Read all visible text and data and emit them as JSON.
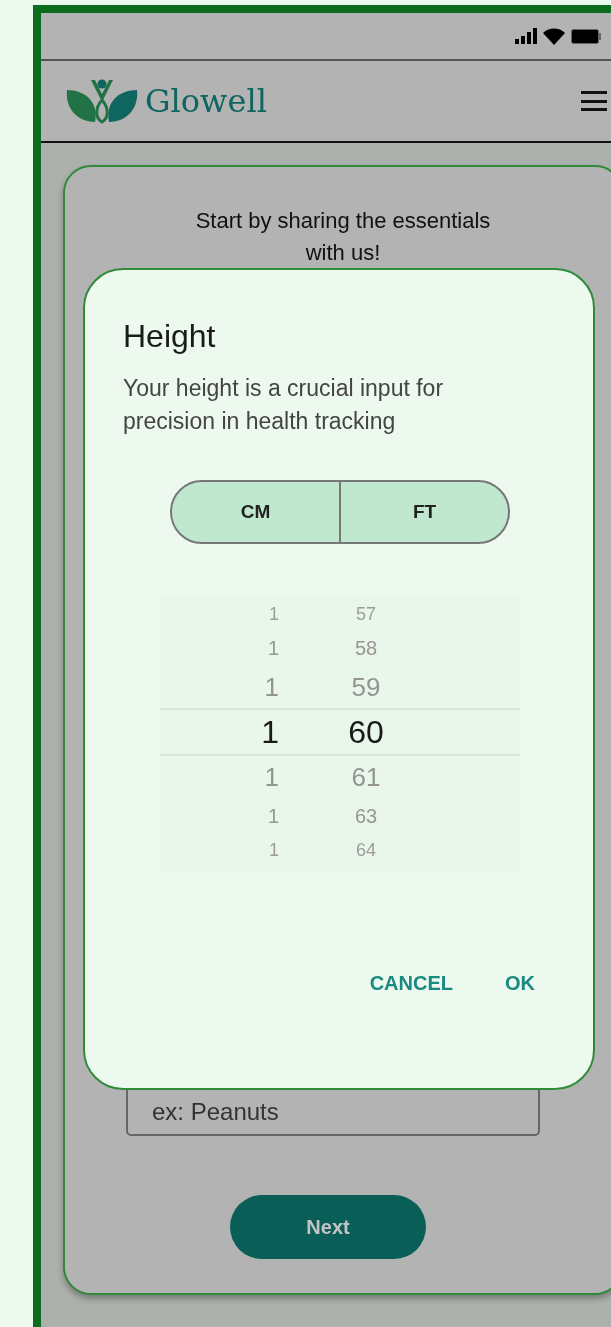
{
  "app": {
    "name": "Glowell"
  },
  "card": {
    "heading": "Start by sharing the essentials with us!",
    "field": {
      "placeholder": "ex: Peanuts"
    },
    "next_button": "Next"
  },
  "dialog": {
    "title": "Height",
    "description": "Your height is a crucial input for precision in health tracking",
    "units": [
      {
        "label": "CM"
      },
      {
        "label": "FT"
      }
    ],
    "picker": [
      {
        "feet": "1",
        "cm": "57",
        "selected": false
      },
      {
        "feet": "1",
        "cm": "58",
        "selected": false
      },
      {
        "feet": "1",
        "cm": "59",
        "selected": false
      },
      {
        "feet": "1",
        "cm": "60",
        "selected": true
      },
      {
        "feet": "1",
        "cm": "61",
        "selected": false
      },
      {
        "feet": "1",
        "cm": "63",
        "selected": false
      },
      {
        "feet": "1",
        "cm": "64",
        "selected": false
      }
    ],
    "buttons": [
      "CANCEL",
      "OK"
    ]
  }
}
